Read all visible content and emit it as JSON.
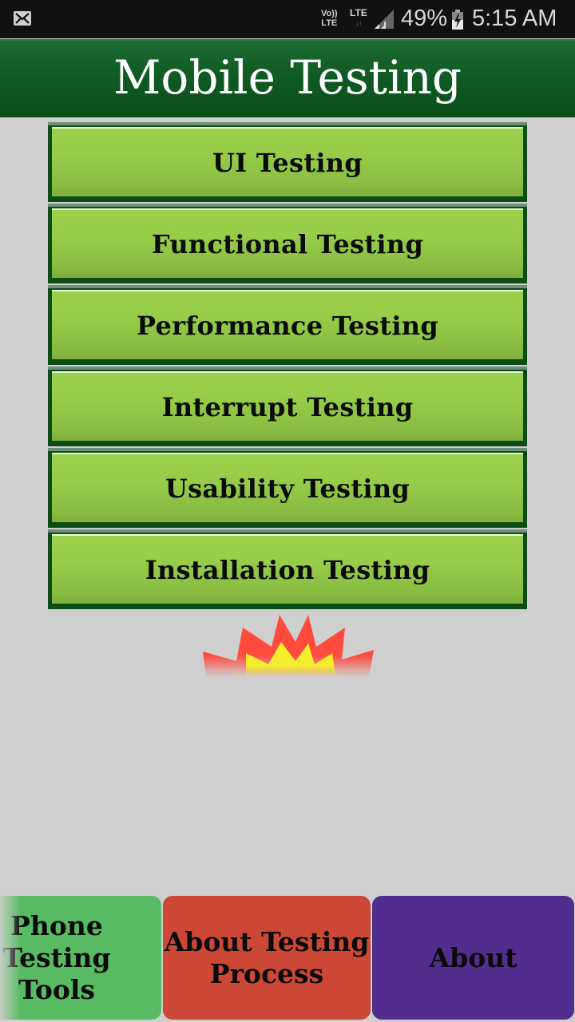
{
  "status_bar": {
    "notification_icon": "mail-icon",
    "volte_label_top": "Vo))",
    "volte_label_bottom": "LTE",
    "network_label": "LTE",
    "network_arrows": "↓↑",
    "signal_icon": "signal-icon",
    "battery_percent": "49%",
    "battery_icon": "battery-charging-icon",
    "time": "5:15 AM"
  },
  "header": {
    "title": "Mobile Testing"
  },
  "menu": {
    "items": [
      {
        "label": "UI Testing"
      },
      {
        "label": "Functional Testing"
      },
      {
        "label": "Performance Testing"
      },
      {
        "label": "Interrupt Testing"
      },
      {
        "label": "Usability Testing"
      },
      {
        "label": "Installation Testing"
      }
    ]
  },
  "decoration": {
    "icon": "starburst-icon"
  },
  "bottom_nav": {
    "tools_line1": "Phone Testing",
    "tools_line2": "Tools",
    "process_line1": "About Testing",
    "process_line2": "Process",
    "about": "About"
  },
  "colors": {
    "header_green": "#0f5a22",
    "button_green": "#96cc48",
    "button_frame": "#0b4d14",
    "tools_green": "#58ba62",
    "process_red": "#cc4735",
    "about_purple": "#512d8e",
    "burst_red": "#ff4a3d",
    "burst_yellow": "#f8f020"
  }
}
